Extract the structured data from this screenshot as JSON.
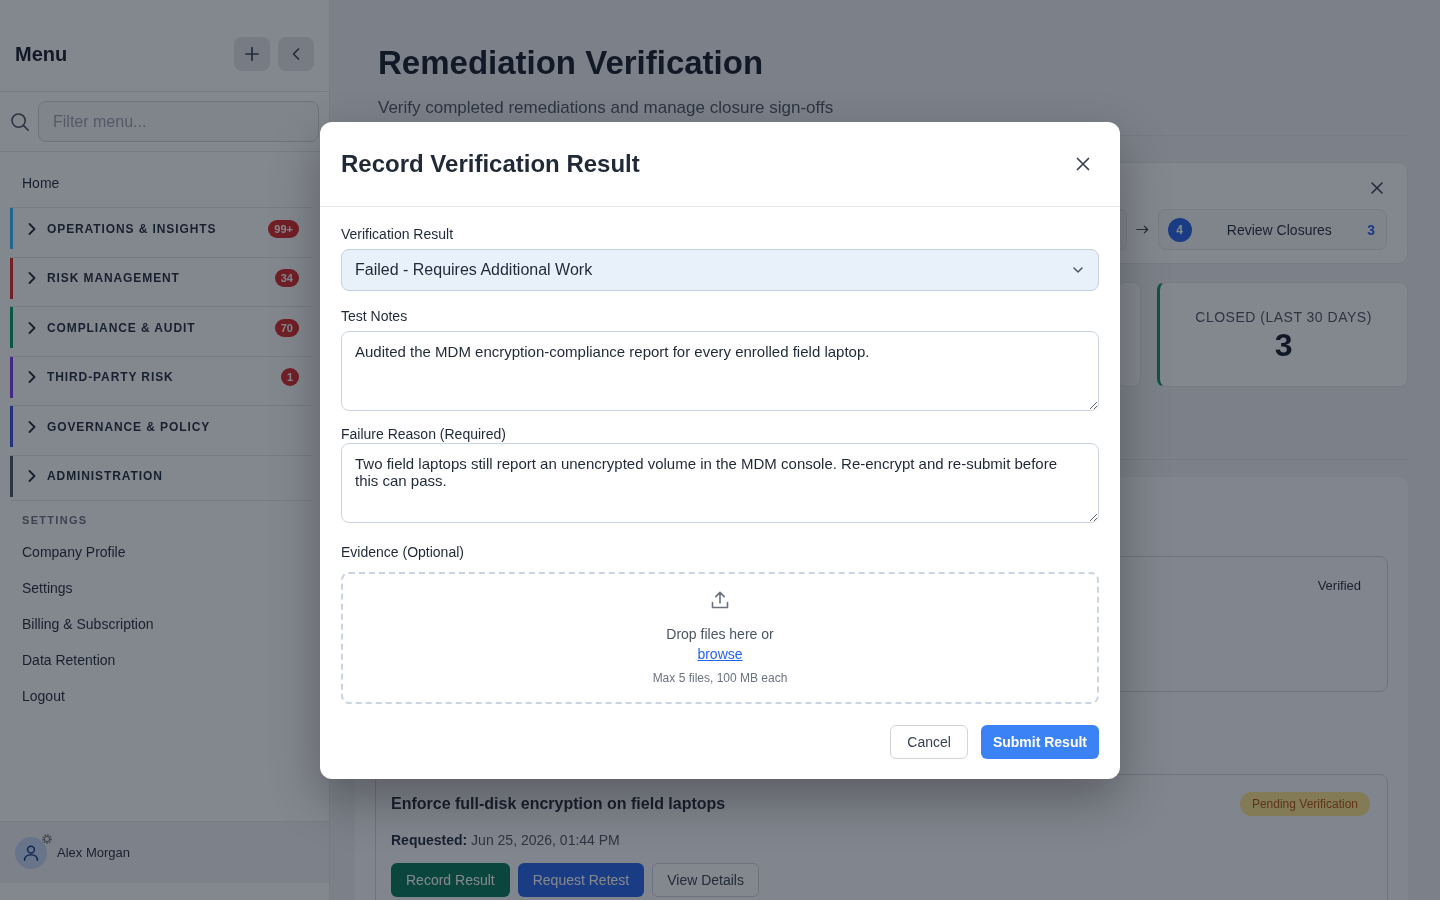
{
  "sidebar": {
    "title": "Menu",
    "filter": {
      "placeholder": "Filter menu..."
    },
    "home": "Home",
    "groups": [
      {
        "label": "OPERATIONS & INSIGHTS",
        "color": "#24678b",
        "badge": "99+",
        "expanded": false
      },
      {
        "label": "RISK MANAGEMENT",
        "color": "#721f27",
        "badge": "34",
        "expanded": false
      },
      {
        "label": "COMPLIANCE & AUDIT",
        "color": "#0b5447",
        "badge": "70",
        "expanded": false
      },
      {
        "label": "THIRD-PARTY RISK",
        "color": "#442886",
        "badge": "1",
        "expanded": false
      },
      {
        "label": "GOVERNANCE & POLICY",
        "color": "#23327c",
        "expanded": false
      },
      {
        "label": "ADMINISTRATION",
        "color": "#2b3547",
        "expanded": false
      }
    ],
    "section_title": "SETTINGS",
    "settings_items": [
      "Company Profile",
      "Settings",
      "Billing & Subscription",
      "Data Retention",
      "Logout"
    ],
    "user": {
      "name": "Alex Morgan"
    }
  },
  "page": {
    "title": "Remediation Verification",
    "subtitle": "Verify completed remediations and manage closure sign-offs"
  },
  "workflow": {
    "steps": [
      {
        "number": "4",
        "label": "Review Closures",
        "count": "3"
      }
    ]
  },
  "stats": [
    {
      "label": "CLOSED (LAST 30 DAYS)",
      "value": "3"
    }
  ],
  "requests": [
    {
      "kind": "compact",
      "status": "Verified"
    },
    {
      "kind": "full",
      "title": "Enforce full-disk encryption on field laptops",
      "status": "Pending Verification",
      "requested": "**Requested:** Jun 25, 2026, 01:44 PM",
      "actions": [
        {
          "label": "Record Result",
          "kind": "success"
        },
        {
          "label": "Request Retest",
          "kind": "primary"
        },
        {
          "label": "View Details",
          "kind": "secondary"
        }
      ]
    }
  ],
  "modal": {
    "title": "Record Verification Result",
    "fields": [
      {
        "kind": "select",
        "label": "Verification Result",
        "value": "Failed - Requires Additional Work"
      },
      {
        "kind": "textarea",
        "label": "Test Notes",
        "value": "Audited the MDM encryption-compliance report for every enrolled field laptop."
      },
      {
        "kind": "textarea",
        "label": "Failure Reason (Required)",
        "value": "Two field laptops still report an unencrypted volume in the MDM console. Re-encrypt and re-submit before this can pass."
      },
      {
        "kind": "upload",
        "label": "Evidence (Optional)",
        "prompt": "Drop files here or",
        "link": "browse",
        "hint": "Max 5 files, 100 MB each"
      }
    ],
    "buttons": [
      {
        "label": "Cancel",
        "kind": "secondary"
      },
      {
        "label": "Submit Result",
        "kind": "primary"
      }
    ]
  }
}
